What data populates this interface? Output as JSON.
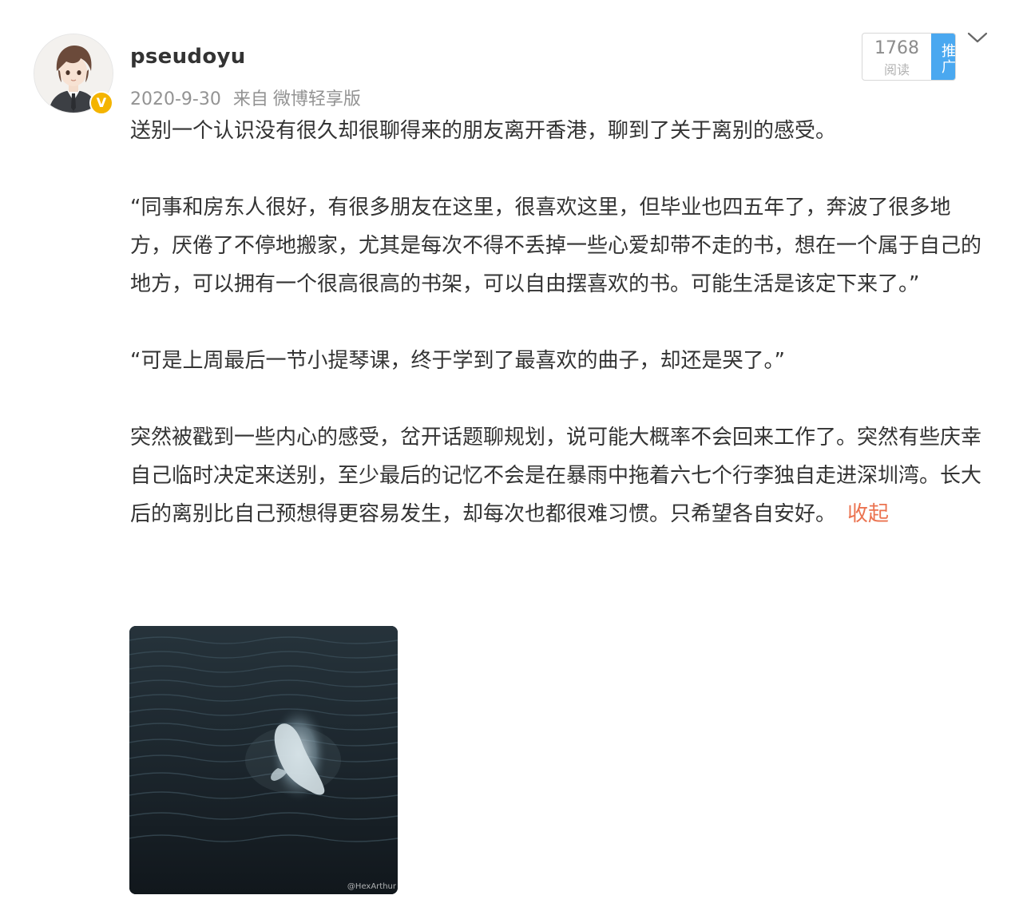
{
  "author": {
    "name": "pseudoyu",
    "avatar_icon": "avatar-icon",
    "verified_badge": "V",
    "verified_color": "#f4b400"
  },
  "post_meta": {
    "date": "2020-9-30",
    "source_prefix": "来自",
    "source": "微博轻享版"
  },
  "stats": {
    "read_count": "1768",
    "read_label": "阅读",
    "promote_label": "推广",
    "promote_color": "#4aa8f0"
  },
  "dropdown_icon": "chevron-down-icon",
  "content": {
    "paragraphs": [
      "送别一个认识没有很久却很聊得来的朋友离开香港，聊到了关于离别的感受。",
      "“同事和房东人很好，有很多朋友在这里，很喜欢这里，但毕业也四五年了，奔波了很多地方，厌倦了不停地搬家，尤其是每次不得不丢掉一些心爱却带不走的书，想在一个属于自己的地方，可以拥有一个很高很高的书架，可以自由摆喜欢的书。可能生活是该定下来了。”",
      "“可是上周最后一节小提琴课，终于学到了最喜欢的曲子，却还是哭了。”",
      "突然被戳到一些内心的感受，岔开话题聊规划，说可能大概率不会回来工作了。突然有些庆幸自己临时决定来送别，至少最后的记忆不会是在暴雨中拖着六七个行李独自走进深圳湾。长大后的离别比自己预想得更容易发生，却每次也都很难习惯。只希望各自安好。"
    ],
    "collapse_label": "收起",
    "collapse_color": "#eb7350"
  },
  "image": {
    "watermark": "@HexArthur"
  }
}
